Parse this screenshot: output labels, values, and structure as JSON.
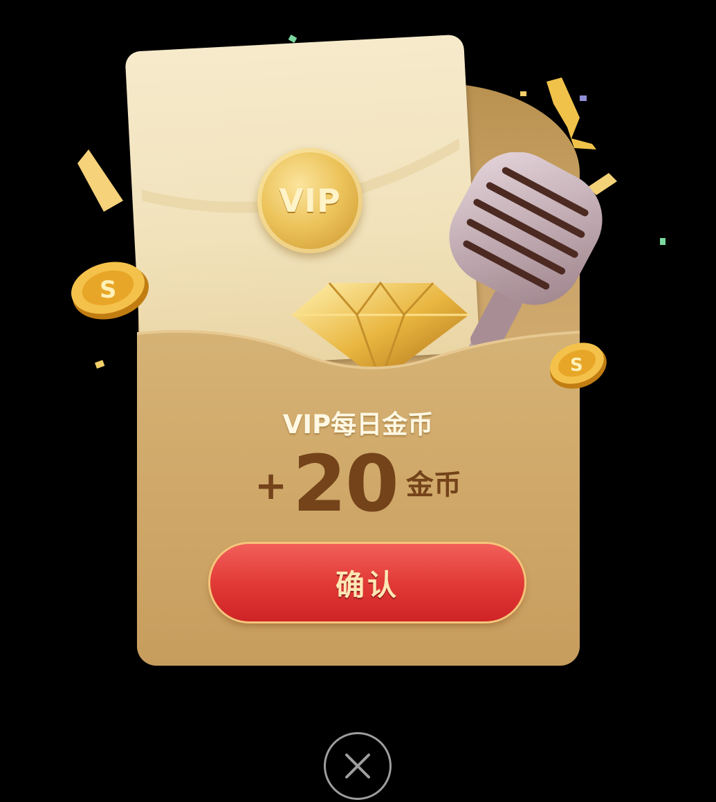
{
  "dialog": {
    "seal_label": "VIP",
    "title": "VIP每日金币",
    "amount_sign": "+",
    "amount_value": "20",
    "amount_unit": "金币",
    "confirm_label": "确认"
  },
  "icons": [
    "vip-seal-icon",
    "diamond-icon",
    "microphone-icon",
    "coin-icon",
    "confetti-icon",
    "close-icon"
  ],
  "colors": {
    "envelope": "#c9a266",
    "letter": "#f3e6c3",
    "button": "#e23b37",
    "amount_text": "#74431a",
    "close_ring": "#9e9e9e"
  }
}
